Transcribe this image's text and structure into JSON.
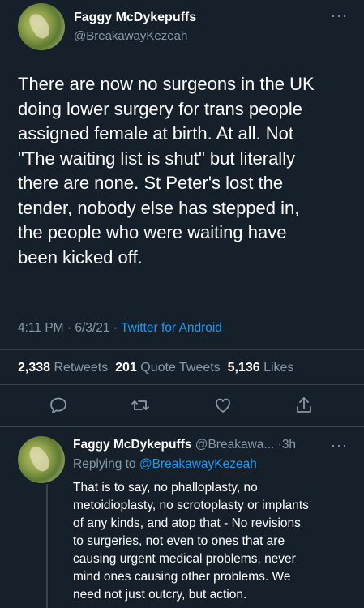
{
  "main_tweet": {
    "display_name": "Faggy McDykepuffs",
    "handle": "@BreakawayKezeah",
    "more_icon": "more-horizontal-icon",
    "text_lines": [
      "There are now no surgeons in the UK",
      "doing lower surgery for trans people",
      "assigned female at birth. At all. Not",
      "\"The waiting list is shut\" but literally",
      "there are none. St Peter's lost the",
      "tender, nobody else has stepped in,",
      "the people who were waiting have",
      "been kicked off."
    ],
    "time": "4:11 PM",
    "date": "6/3/21",
    "separator": "·",
    "source": "Twitter for Android",
    "stats": {
      "retweets_count": "2,338",
      "retweets_label": "Retweets",
      "quotes_count": "201",
      "quotes_label": "Quote Tweets",
      "likes_count": "5,136",
      "likes_label": "Likes"
    }
  },
  "actions": {
    "icons": [
      "reply-icon",
      "retweet-icon",
      "like-icon",
      "share-icon"
    ]
  },
  "reply": {
    "display_name": "Faggy McDykepuffs",
    "handle_truncated": "@Breakawa...",
    "separator": "·",
    "time_ago": "3h",
    "replying_to_label": "Replying to",
    "replying_to_handle": "@BreakawayKezeah",
    "text_lines": [
      "That is to say, no phalloplasty, no",
      "metoidioplasty, no scrotoplasty or implants",
      "of any kinds, and atop that - No revisions",
      "to surgeries, not even to ones that are",
      "causing urgent medical problems, never",
      "mind ones causing other problems. We",
      "need not just outcry, but action."
    ]
  },
  "colors": {
    "background": "#15202b",
    "secondary_text": "#8b98a5",
    "accent": "#1d9bf0",
    "divider": "#38444d"
  }
}
